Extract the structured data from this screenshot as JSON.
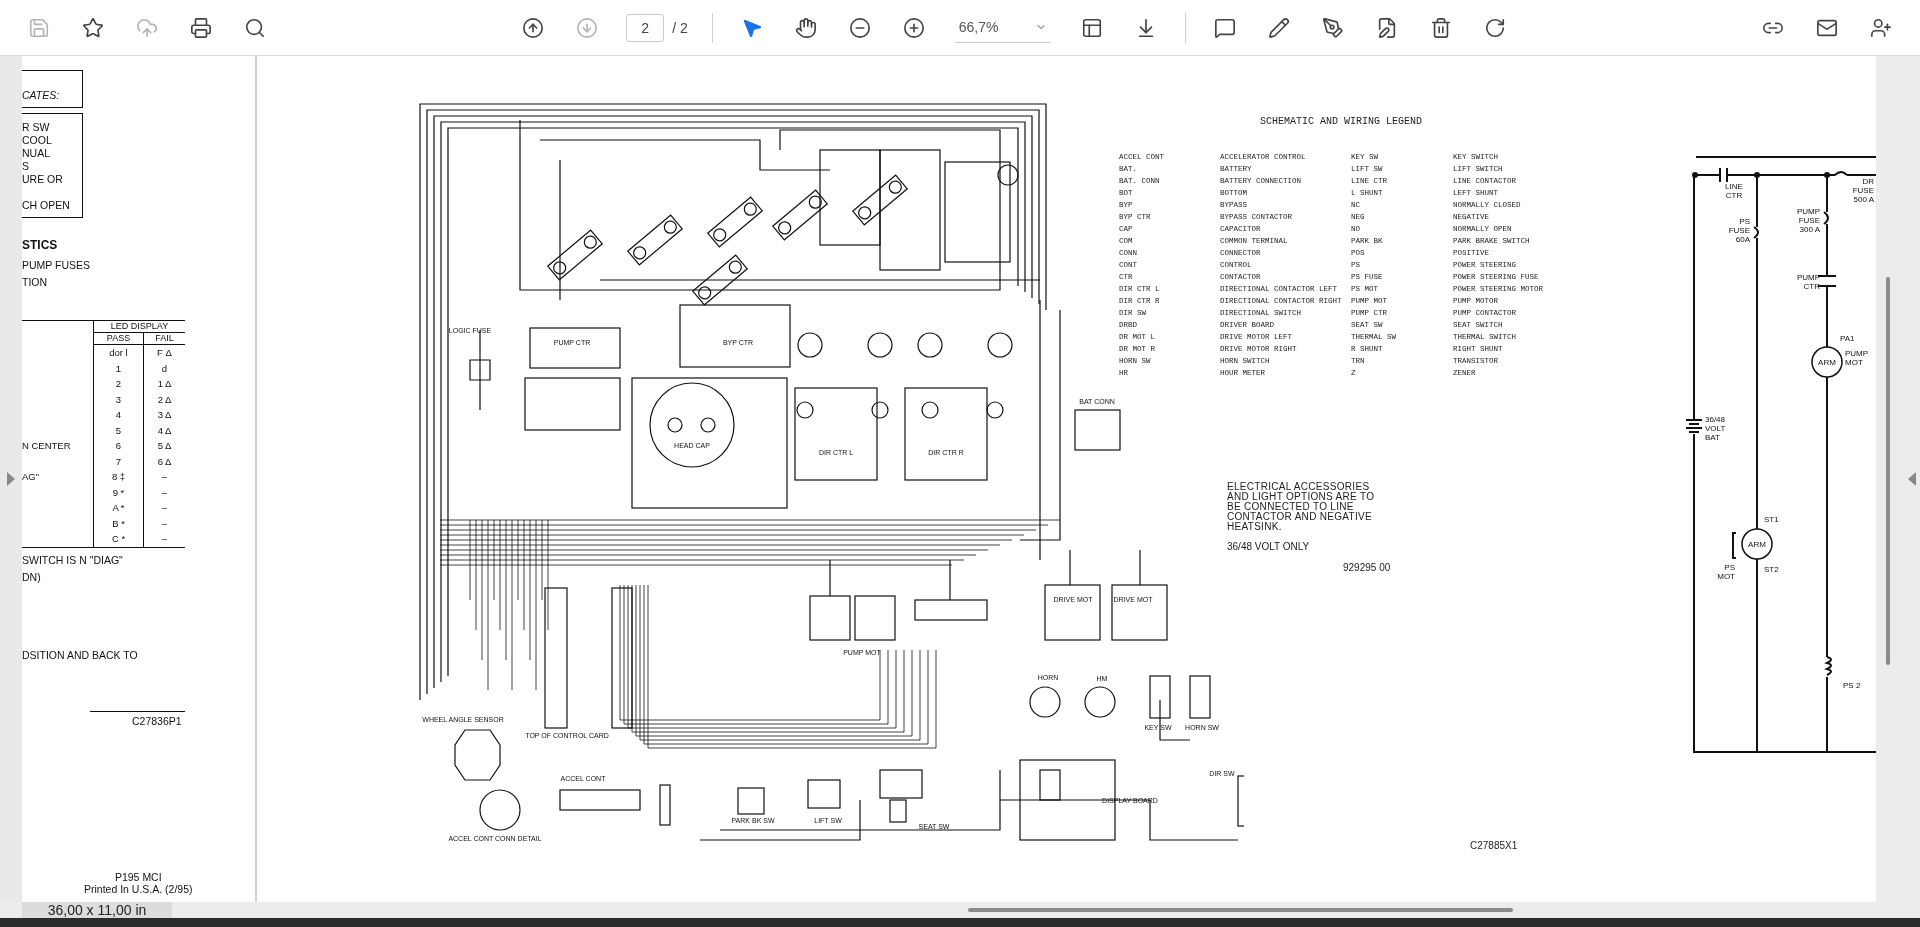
{
  "toolbar": {
    "page_number": "2",
    "page_total": "/ 2",
    "zoom": "66,7%"
  },
  "left_page": {
    "box_caption": "CATES:",
    "box_lines": [
      "R SW",
      "COOL",
      "NUAL",
      "S",
      "URE OR",
      "CH OPEN"
    ],
    "heading": "STICS",
    "lines": [
      "PUMP FUSES",
      "TION"
    ],
    "table": {
      "group_header": "LED DISPLAY",
      "columns": [
        "PASS",
        "FAIL"
      ],
      "rows": [
        {
          "pass": "dor l",
          "fail": "F Δ"
        },
        {
          "pass": "1",
          "fail": "d"
        },
        {
          "pass": "2",
          "fail": "1 Δ"
        },
        {
          "pass": "3",
          "fail": "2 Δ"
        },
        {
          "pass": "4",
          "fail": "3 Δ"
        },
        {
          "pass": "5",
          "fail": "4 Δ"
        },
        {
          "label": "N CENTER",
          "pass": "6",
          "fail": "5 Δ"
        },
        {
          "pass": "7",
          "fail": "6 Δ"
        },
        {
          "label": "AG\"",
          "pass": "8 ‡",
          "fail": "–"
        },
        {
          "pass": "9 *",
          "fail": "–"
        },
        {
          "pass": "A *",
          "fail": "–"
        },
        {
          "pass": "B *",
          "fail": "–"
        },
        {
          "pass": "C *",
          "fail": "–"
        }
      ]
    },
    "notes": [
      "SWITCH IS N \"DIAG\"",
      "DN)",
      "DSITION AND BACK TO"
    ],
    "drawing_number": "C27836P1",
    "footer": [
      "P195 MCI",
      "Printed In U.S.A. (2/95)"
    ]
  },
  "diagram": {
    "labels": [
      "LOGIC FUSE",
      "PUMP CTR",
      "BYP CTR",
      "HEAD CAP",
      "DIR CTR L",
      "DIR CTR R",
      "BAT CONN",
      "DRIVE MOT",
      "DRIVE MOT",
      "PUMP MOT",
      "HORN",
      "HM",
      "KEY SW",
      "HORN SW",
      "WHEEL ANGLE SENSOR",
      "TOP OF CONTROL CARD",
      "ACCEL CONT",
      "ACCEL CONT CONN DETAIL",
      "PARK BK SW",
      "LIFT SW",
      "SEAT SW",
      "DISPLAY BOARD",
      "DIR SW"
    ]
  },
  "legend": {
    "title": "SCHEMATIC AND WIRING LEGEND",
    "entries": [
      {
        "abbr": "ACCEL CONT",
        "meaning": "ACCELERATOR CONTROL"
      },
      {
        "abbr": "BAT.",
        "meaning": "BATTERY"
      },
      {
        "abbr": "BAT. CONN",
        "meaning": "BATTERY CONNECTION"
      },
      {
        "abbr": "BOT",
        "meaning": "BOTTOM"
      },
      {
        "abbr": "BYP",
        "meaning": "BYPASS"
      },
      {
        "abbr": "BYP CTR",
        "meaning": "BYPASS CONTACTOR"
      },
      {
        "abbr": "CAP",
        "meaning": "CAPACITOR"
      },
      {
        "abbr": "COM",
        "meaning": "COMMON TERMINAL"
      },
      {
        "abbr": "CONN",
        "meaning": "CONNECTOR"
      },
      {
        "abbr": "CONT",
        "meaning": "CONTROL"
      },
      {
        "abbr": "CTR",
        "meaning": "CONTACTOR"
      },
      {
        "abbr": "DIR CTR L",
        "meaning": "DIRECTIONAL CONTACTOR LEFT"
      },
      {
        "abbr": "DIR CTR R",
        "meaning": "DIRECTIONAL CONTACTOR RIGHT"
      },
      {
        "abbr": "DIR SW",
        "meaning": "DIRECTIONAL SWITCH"
      },
      {
        "abbr": "DRBD",
        "meaning": "DRIVER BOARD"
      },
      {
        "abbr": "DR MOT L",
        "meaning": "DRIVE MOTOR LEFT"
      },
      {
        "abbr": "DR MOT R",
        "meaning": "DRIVE MOTOR RIGHT"
      },
      {
        "abbr": "HORN SW",
        "meaning": "HORN SWITCH"
      },
      {
        "abbr": "HR",
        "meaning": "HOUR METER"
      },
      {
        "abbr": "KEY SW",
        "meaning": "KEY SWITCH"
      },
      {
        "abbr": "LIFT SW",
        "meaning": "LIFT SWITCH"
      },
      {
        "abbr": "LINE CTR",
        "meaning": "LINE CONTACTOR"
      },
      {
        "abbr": "L SHUNT",
        "meaning": "LEFT SHUNT"
      },
      {
        "abbr": "NC",
        "meaning": "NORMALLY CLOSED"
      },
      {
        "abbr": "NEG",
        "meaning": "NEGATIVE"
      },
      {
        "abbr": "NO",
        "meaning": "NORMALLY OPEN"
      },
      {
        "abbr": "PARK BK",
        "meaning": "PARK BRAKE SWITCH"
      },
      {
        "abbr": "POS",
        "meaning": "POSITIVE"
      },
      {
        "abbr": "PS",
        "meaning": "POWER STEERING"
      },
      {
        "abbr": "PS FUSE",
        "meaning": "POWER STEERING FUSE"
      },
      {
        "abbr": "PS MOT",
        "meaning": "POWER STEERING MOTOR"
      },
      {
        "abbr": "PUMP MOT",
        "meaning": "PUMP MOTOR"
      },
      {
        "abbr": "PUMP CTR",
        "meaning": "PUMP CONTACTOR"
      },
      {
        "abbr": "SEAT SW",
        "meaning": "SEAT SWITCH"
      },
      {
        "abbr": "THERMAL SW",
        "meaning": "THERMAL SWITCH"
      },
      {
        "abbr": "R SHUNT",
        "meaning": "RIGHT SHUNT"
      },
      {
        "abbr": "TRN",
        "meaning": "TRANSISTOR"
      },
      {
        "abbr": "Z",
        "meaning": "ZENER"
      }
    ]
  },
  "accessory_note": "ELECTRICAL ACCESSORIES\nAND LIGHT OPTIONS ARE TO\nBE CONNECTED TO LINE\nCONTACTOR AND NEGATIVE\nHEATSINK.",
  "voltage_note": "36/48 VOLT ONLY",
  "part_number": "929295 00",
  "sheet_number": "C27885X1",
  "schematic": {
    "labels": [
      [
        "LINE",
        "CTR"
      ],
      [
        "DR",
        "FUSE",
        "500 A"
      ],
      [
        "PS",
        "FUSE",
        "60A"
      ],
      [
        "PUMP",
        "FUSE",
        "300 A"
      ],
      [
        "PUMP",
        "CTR"
      ],
      [
        "PA1"
      ],
      [
        "ARM"
      ],
      [
        "PUMP",
        "MOT"
      ],
      [
        "36/48",
        "VOLT",
        "BAT"
      ],
      [
        "ST1"
      ],
      [
        "ARM"
      ],
      [
        "PS",
        "MOT"
      ],
      [
        "ST2"
      ],
      [
        "PS 2"
      ]
    ]
  },
  "status_bar": {
    "page_size": "36,00 x 11,00 in"
  }
}
